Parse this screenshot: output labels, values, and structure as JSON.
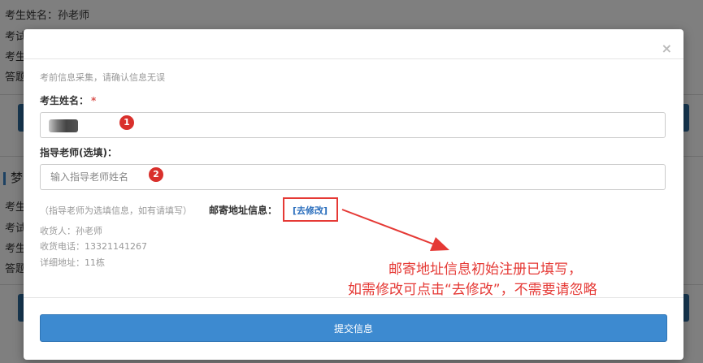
{
  "background": {
    "lines_top": [
      "考生姓名：孙老师",
      "考试",
      "考生",
      "答题"
    ],
    "section_title": "梦",
    "lines_bottom": [
      "考生",
      "考试",
      "考生",
      "答题"
    ]
  },
  "modal": {
    "close_glyph": "×",
    "notice": "考前信息采集，请确认信息无误",
    "name_label": "考生姓名：",
    "required_mark": "*",
    "teacher_label": "指导老师(选填)：",
    "teacher_placeholder": "输入指导老师姓名",
    "teacher_hint": "（指导老师为选填信息，如有请填写）",
    "address_label": "邮寄地址信息：",
    "edit_link": "[去修改]",
    "receiver": "收货人：孙老师",
    "phone": "收货电话：13321141267",
    "address": "详细地址：11栋",
    "submit_label": "提交信息"
  },
  "annotations": {
    "badge_1": "1",
    "badge_2": "2",
    "note_line_1": "邮寄地址信息初始注册已填写，",
    "note_line_2": "如需修改可点击“去修改”，不需要请忽略"
  },
  "colors": {
    "primary": "#3d8ad0",
    "annotation_red": "#e53935",
    "badge_red": "#d9302c",
    "link_blue": "#2a6ebd"
  }
}
